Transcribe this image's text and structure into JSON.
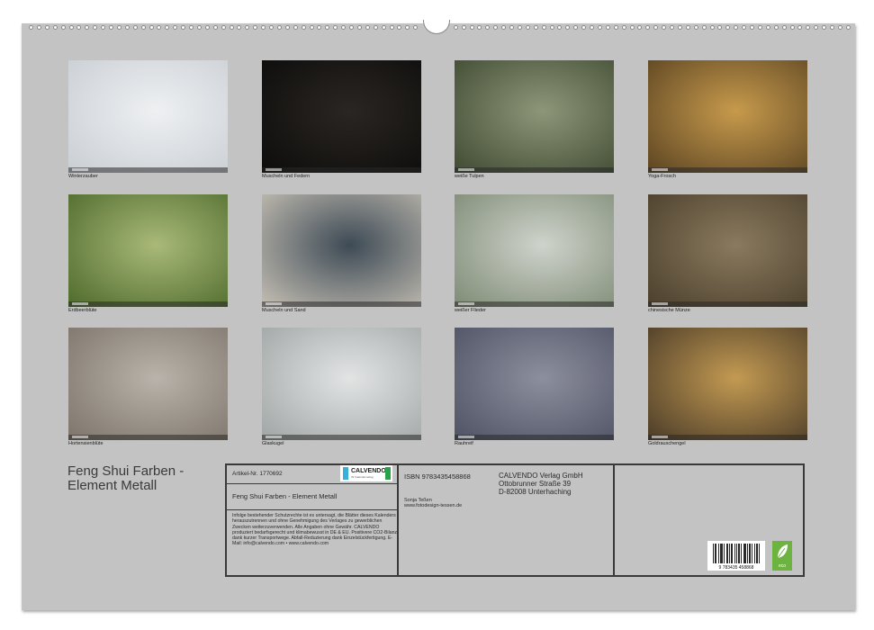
{
  "calendar": {
    "title_line1": "Feng Shui Farben -",
    "title_line2": "Element Metall"
  },
  "months": [
    {
      "caption": "Winterzauber",
      "colors": [
        "#eef0f2",
        "#c9ced3"
      ]
    },
    {
      "caption": "Muscheln und Federn",
      "colors": [
        "#2a2622",
        "#0d0c0b"
      ]
    },
    {
      "caption": "weiße Tulpen",
      "colors": [
        "#8e9679",
        "#3f4a31"
      ]
    },
    {
      "caption": "Yoga-Frosch",
      "colors": [
        "#c79a4c",
        "#5b4422"
      ]
    },
    {
      "caption": "Erdbeerblüte",
      "colors": [
        "#a9b978",
        "#4d6a2c"
      ]
    },
    {
      "caption": "Muscheln und Sand",
      "colors": [
        "#3d4a55",
        "#c6c0b4"
      ]
    },
    {
      "caption": "weißer Flieder",
      "colors": [
        "#cfd3cc",
        "#7d8a74"
      ]
    },
    {
      "caption": "chinesische Münze",
      "colors": [
        "#8a7a5e",
        "#4b3f2c"
      ]
    },
    {
      "caption": "Hortensienblüte",
      "colors": [
        "#b9b3ab",
        "#7d746a"
      ]
    },
    {
      "caption": "Glaskugel",
      "colors": [
        "#e2e4e4",
        "#9fa5a4"
      ]
    },
    {
      "caption": "Rauhreif",
      "colors": [
        "#8c8f9d",
        "#4f5264"
      ]
    },
    {
      "caption": "Goldrauschengel",
      "colors": [
        "#c39a52",
        "#4a3b28"
      ]
    }
  ],
  "info": {
    "article": "Artikel-Nr. 1770692",
    "product_title": "Feng Shui Farben - Element Metall",
    "legal": "Infolge bestehender Schutzrechte ist es untersagt, die Blätter dieses Kalenders herauszutrennen und ohne Genehmigung des Verlages zu gewerblichen Zwecken weiterzuverwenden. Alle Angaben ohne Gewähr. CALVENDO produziert bedarfsgerecht und klimabewusst in DE & EU. Positivere CO2-Bilanz dank kurzer Transportwege. Abfall-Reduzierung dank Einzelstückfertigung. E-Mail: info@calvendo.com • www.calvendo.com",
    "isbn": "ISBN 9783435458868",
    "author": "Sonja Teßen",
    "author_url": "www.fotodesign-tessen.de",
    "publisher_line1": "CALVENDO Verlag GmbH",
    "publisher_line2": "Ottobrunner Straße 39",
    "publisher_line3": "D-82008 Unterhaching",
    "logo_text": "CALVENDO",
    "logo_sub": "Ihr Kalenderverlag",
    "barcode_digits": "9 783435 458868",
    "eco_label": "eco"
  }
}
